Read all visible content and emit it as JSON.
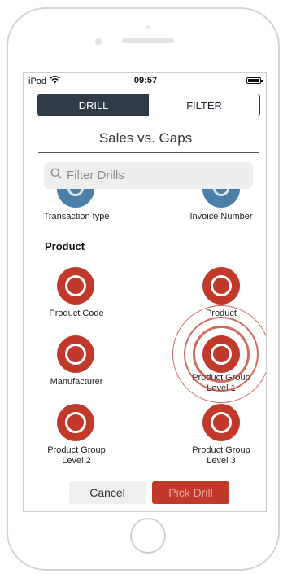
{
  "status_bar": {
    "carrier": "iPod",
    "time": "09:57"
  },
  "tabs": [
    {
      "label": "DRILL",
      "active": true
    },
    {
      "label": "FILTER",
      "active": false
    }
  ],
  "title": "Sales vs. Gaps",
  "search": {
    "placeholder": "Filter Drills",
    "value": ""
  },
  "previous_items": [
    {
      "label": "Transaction type"
    },
    {
      "label": "Invoice Number"
    }
  ],
  "section": {
    "header": "Product",
    "items": [
      {
        "label": "Product Code"
      },
      {
        "label": "Product"
      },
      {
        "label": "Manufacturer"
      },
      {
        "label": "Product Group Level 1",
        "selected": true
      },
      {
        "label": "Product Group Level 2"
      },
      {
        "label": "Product Group Level 3"
      }
    ]
  },
  "actions": {
    "cancel": "Cancel",
    "pick": "Pick Drill"
  },
  "colors": {
    "accent": "#c0392b",
    "header_dark": "#2f3b46",
    "previous_icon": "#4a7faa"
  }
}
